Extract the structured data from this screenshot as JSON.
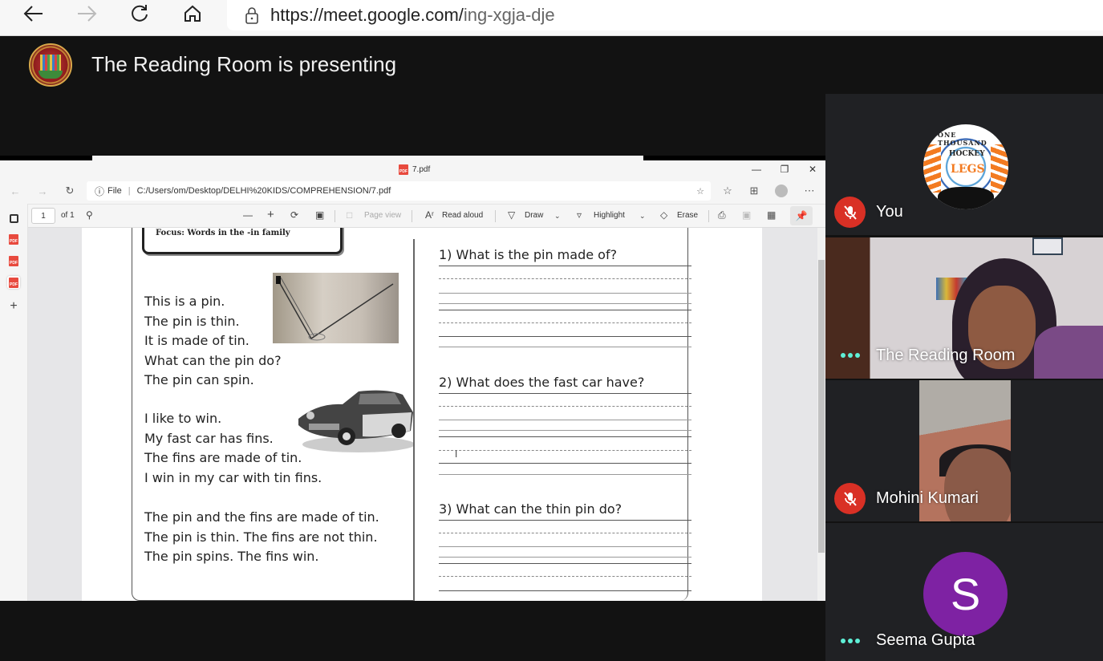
{
  "browser": {
    "url_host": "https://meet.google.com/",
    "url_path": "ing-xgja-dje",
    "icons": [
      "back-icon",
      "forward-icon",
      "reload-icon",
      "home-icon",
      "lock-icon"
    ]
  },
  "meet": {
    "presenter_banner": "The Reading Room is presenting",
    "presenter_logo": "The Reading Room"
  },
  "pdf_window": {
    "tab_title": "7.pdf",
    "address_prefix": "File",
    "address_path": "C:/Users/om/Desktop/DELHI%20KIDS/COMPREHENSION/7.pdf",
    "page_number": "1",
    "page_count": "of 1",
    "toolbar": {
      "page_view": "Page view",
      "read_aloud": "Read aloud",
      "draw": "Draw",
      "highlight": "Highlight",
      "erase": "Erase"
    }
  },
  "document": {
    "focus_label": "Focus: Words in the -in  family",
    "story_paragraphs": [
      [
        "This is a pin.",
        "The pin is thin.",
        "It is made of tin.",
        "What can the pin do?",
        "The pin can spin."
      ],
      [
        "I like to win.",
        "My fast car has fins.",
        "The fins are made of tin.",
        "I win in my car with tin fins."
      ],
      [
        "The pin and the fins are made of tin.",
        "The pin is thin. The fins are not thin.",
        "The pin spins. The fins win."
      ]
    ],
    "questions": [
      "1) What is the pin made of?",
      "2) What does the fast car have?",
      "3) What can the thin pin do?"
    ]
  },
  "participants": [
    {
      "name": "You",
      "status": "muted",
      "avatar": "One Thousand Hockey Legs logo",
      "logo_top": "ONE THOUSAND",
      "logo_mid": "HOCKEY",
      "logo_main": "LEGS"
    },
    {
      "name": "The Reading Room",
      "status": "speaking-menu",
      "avatar": "video"
    },
    {
      "name": "Mohini Kumari",
      "status": "muted",
      "avatar": "video"
    },
    {
      "name": "Seema Gupta",
      "status": "speaking-menu",
      "avatar_letter": "S",
      "avatar_color": "#7e22a3"
    }
  ],
  "colors": {
    "mute_red": "#d93025",
    "dots_teal": "#5ff0d7",
    "tile_bg": "#202124",
    "stage_bg": "#121212"
  }
}
